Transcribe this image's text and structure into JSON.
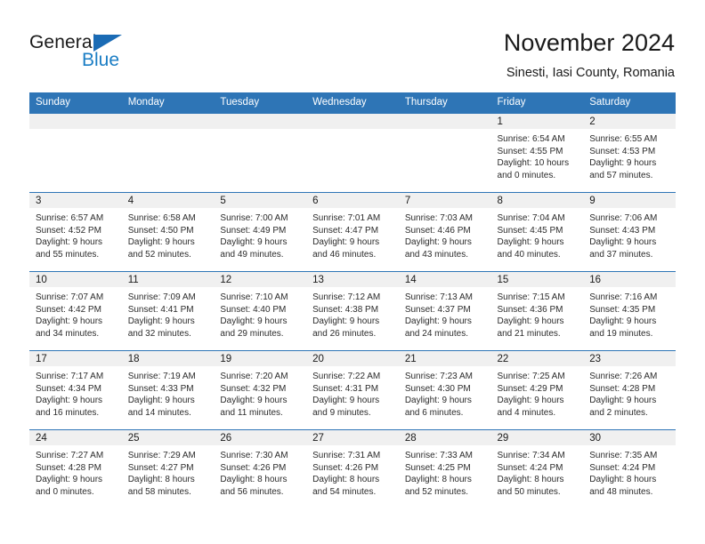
{
  "brand": {
    "name_part1": "General",
    "name_part2": "Blue",
    "flag_icon": "blue-triangle-flag-icon",
    "accent_color": "#1a7dc4"
  },
  "header": {
    "title": "November 2024",
    "subtitle": "Sinesti, Iasi County, Romania"
  },
  "theme": {
    "header_row_bg": "#2e75b6",
    "daynum_bg": "#f0f0f0",
    "border_color": "#2e75b6",
    "text_color": "#2b2b2b"
  },
  "calendar": {
    "columns": [
      "Sunday",
      "Monday",
      "Tuesday",
      "Wednesday",
      "Thursday",
      "Friday",
      "Saturday"
    ],
    "weeks": [
      [
        {
          "day": "",
          "empty": true,
          "lines": []
        },
        {
          "day": "",
          "empty": true,
          "lines": []
        },
        {
          "day": "",
          "empty": true,
          "lines": []
        },
        {
          "day": "",
          "empty": true,
          "lines": []
        },
        {
          "day": "",
          "empty": true,
          "lines": []
        },
        {
          "day": "1",
          "empty": false,
          "lines": [
            "Sunrise: 6:54 AM",
            "Sunset: 4:55 PM",
            "Daylight: 10 hours",
            "and 0 minutes."
          ]
        },
        {
          "day": "2",
          "empty": false,
          "lines": [
            "Sunrise: 6:55 AM",
            "Sunset: 4:53 PM",
            "Daylight: 9 hours",
            "and 57 minutes."
          ]
        }
      ],
      [
        {
          "day": "3",
          "empty": false,
          "lines": [
            "Sunrise: 6:57 AM",
            "Sunset: 4:52 PM",
            "Daylight: 9 hours",
            "and 55 minutes."
          ]
        },
        {
          "day": "4",
          "empty": false,
          "lines": [
            "Sunrise: 6:58 AM",
            "Sunset: 4:50 PM",
            "Daylight: 9 hours",
            "and 52 minutes."
          ]
        },
        {
          "day": "5",
          "empty": false,
          "lines": [
            "Sunrise: 7:00 AM",
            "Sunset: 4:49 PM",
            "Daylight: 9 hours",
            "and 49 minutes."
          ]
        },
        {
          "day": "6",
          "empty": false,
          "lines": [
            "Sunrise: 7:01 AM",
            "Sunset: 4:47 PM",
            "Daylight: 9 hours",
            "and 46 minutes."
          ]
        },
        {
          "day": "7",
          "empty": false,
          "lines": [
            "Sunrise: 7:03 AM",
            "Sunset: 4:46 PM",
            "Daylight: 9 hours",
            "and 43 minutes."
          ]
        },
        {
          "day": "8",
          "empty": false,
          "lines": [
            "Sunrise: 7:04 AM",
            "Sunset: 4:45 PM",
            "Daylight: 9 hours",
            "and 40 minutes."
          ]
        },
        {
          "day": "9",
          "empty": false,
          "lines": [
            "Sunrise: 7:06 AM",
            "Sunset: 4:43 PM",
            "Daylight: 9 hours",
            "and 37 minutes."
          ]
        }
      ],
      [
        {
          "day": "10",
          "empty": false,
          "lines": [
            "Sunrise: 7:07 AM",
            "Sunset: 4:42 PM",
            "Daylight: 9 hours",
            "and 34 minutes."
          ]
        },
        {
          "day": "11",
          "empty": false,
          "lines": [
            "Sunrise: 7:09 AM",
            "Sunset: 4:41 PM",
            "Daylight: 9 hours",
            "and 32 minutes."
          ]
        },
        {
          "day": "12",
          "empty": false,
          "lines": [
            "Sunrise: 7:10 AM",
            "Sunset: 4:40 PM",
            "Daylight: 9 hours",
            "and 29 minutes."
          ]
        },
        {
          "day": "13",
          "empty": false,
          "lines": [
            "Sunrise: 7:12 AM",
            "Sunset: 4:38 PM",
            "Daylight: 9 hours",
            "and 26 minutes."
          ]
        },
        {
          "day": "14",
          "empty": false,
          "lines": [
            "Sunrise: 7:13 AM",
            "Sunset: 4:37 PM",
            "Daylight: 9 hours",
            "and 24 minutes."
          ]
        },
        {
          "day": "15",
          "empty": false,
          "lines": [
            "Sunrise: 7:15 AM",
            "Sunset: 4:36 PM",
            "Daylight: 9 hours",
            "and 21 minutes."
          ]
        },
        {
          "day": "16",
          "empty": false,
          "lines": [
            "Sunrise: 7:16 AM",
            "Sunset: 4:35 PM",
            "Daylight: 9 hours",
            "and 19 minutes."
          ]
        }
      ],
      [
        {
          "day": "17",
          "empty": false,
          "lines": [
            "Sunrise: 7:17 AM",
            "Sunset: 4:34 PM",
            "Daylight: 9 hours",
            "and 16 minutes."
          ]
        },
        {
          "day": "18",
          "empty": false,
          "lines": [
            "Sunrise: 7:19 AM",
            "Sunset: 4:33 PM",
            "Daylight: 9 hours",
            "and 14 minutes."
          ]
        },
        {
          "day": "19",
          "empty": false,
          "lines": [
            "Sunrise: 7:20 AM",
            "Sunset: 4:32 PM",
            "Daylight: 9 hours",
            "and 11 minutes."
          ]
        },
        {
          "day": "20",
          "empty": false,
          "lines": [
            "Sunrise: 7:22 AM",
            "Sunset: 4:31 PM",
            "Daylight: 9 hours",
            "and 9 minutes."
          ]
        },
        {
          "day": "21",
          "empty": false,
          "lines": [
            "Sunrise: 7:23 AM",
            "Sunset: 4:30 PM",
            "Daylight: 9 hours",
            "and 6 minutes."
          ]
        },
        {
          "day": "22",
          "empty": false,
          "lines": [
            "Sunrise: 7:25 AM",
            "Sunset: 4:29 PM",
            "Daylight: 9 hours",
            "and 4 minutes."
          ]
        },
        {
          "day": "23",
          "empty": false,
          "lines": [
            "Sunrise: 7:26 AM",
            "Sunset: 4:28 PM",
            "Daylight: 9 hours",
            "and 2 minutes."
          ]
        }
      ],
      [
        {
          "day": "24",
          "empty": false,
          "lines": [
            "Sunrise: 7:27 AM",
            "Sunset: 4:28 PM",
            "Daylight: 9 hours",
            "and 0 minutes."
          ]
        },
        {
          "day": "25",
          "empty": false,
          "lines": [
            "Sunrise: 7:29 AM",
            "Sunset: 4:27 PM",
            "Daylight: 8 hours",
            "and 58 minutes."
          ]
        },
        {
          "day": "26",
          "empty": false,
          "lines": [
            "Sunrise: 7:30 AM",
            "Sunset: 4:26 PM",
            "Daylight: 8 hours",
            "and 56 minutes."
          ]
        },
        {
          "day": "27",
          "empty": false,
          "lines": [
            "Sunrise: 7:31 AM",
            "Sunset: 4:26 PM",
            "Daylight: 8 hours",
            "and 54 minutes."
          ]
        },
        {
          "day": "28",
          "empty": false,
          "lines": [
            "Sunrise: 7:33 AM",
            "Sunset: 4:25 PM",
            "Daylight: 8 hours",
            "and 52 minutes."
          ]
        },
        {
          "day": "29",
          "empty": false,
          "lines": [
            "Sunrise: 7:34 AM",
            "Sunset: 4:24 PM",
            "Daylight: 8 hours",
            "and 50 minutes."
          ]
        },
        {
          "day": "30",
          "empty": false,
          "lines": [
            "Sunrise: 7:35 AM",
            "Sunset: 4:24 PM",
            "Daylight: 8 hours",
            "and 48 minutes."
          ]
        }
      ]
    ]
  }
}
